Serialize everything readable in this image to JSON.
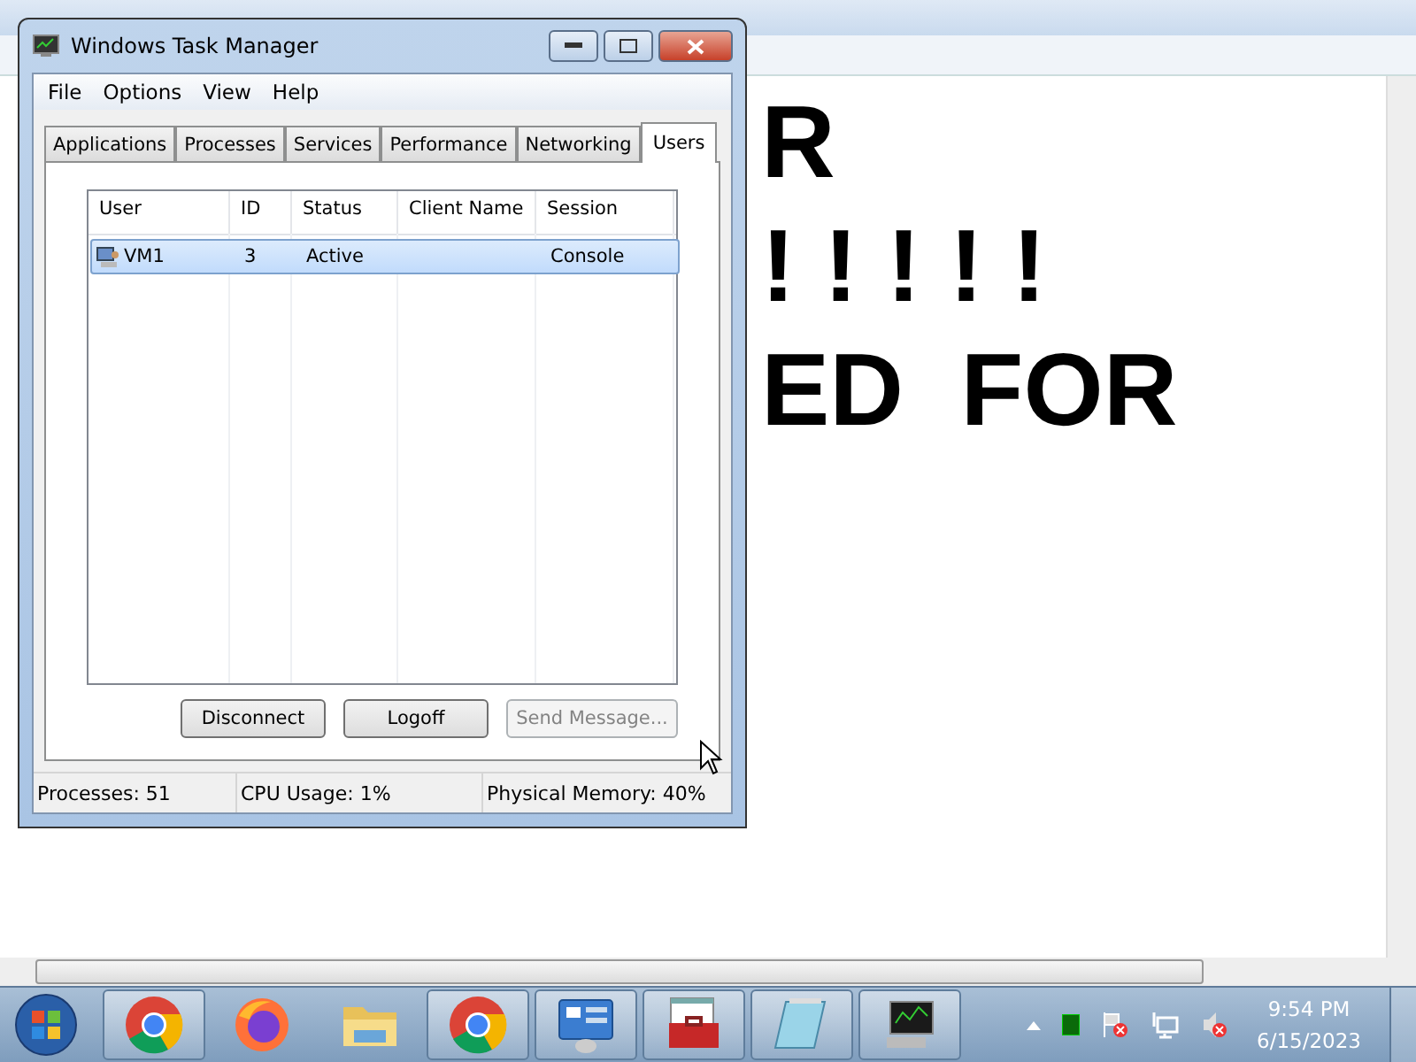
{
  "notepad": {
    "text_lines": [
      "R",
      "! ! ! ! !",
      "ED  FOR"
    ]
  },
  "task_manager": {
    "title": "Windows Task Manager",
    "menu": [
      "File",
      "Options",
      "View",
      "Help"
    ],
    "tabs": [
      {
        "label": "Applications",
        "selected": false
      },
      {
        "label": "Processes",
        "selected": false
      },
      {
        "label": "Services",
        "selected": false
      },
      {
        "label": "Performance",
        "selected": false
      },
      {
        "label": "Networking",
        "selected": false
      },
      {
        "label": "Users",
        "selected": true
      }
    ],
    "table": {
      "columns": [
        "User",
        "ID",
        "Status",
        "Client Name",
        "Session"
      ],
      "rows": [
        {
          "cells": [
            "VM1",
            "3",
            "Active",
            "",
            "Console"
          ],
          "selected": true
        }
      ]
    },
    "buttons": [
      {
        "label": "Disconnect",
        "disabled": false
      },
      {
        "label": "Logoff",
        "disabled": false
      },
      {
        "label": "Send Message...",
        "disabled": true
      }
    ],
    "status_bar": [
      "Processes: 51",
      "CPU Usage: 1%",
      "Physical Memory: 40%"
    ]
  },
  "taskbar": {
    "apps": [
      {
        "kind": "chrome",
        "active": true
      },
      {
        "kind": "firefox",
        "active": false
      },
      {
        "kind": "folder",
        "active": false
      },
      {
        "kind": "chrome",
        "active": true
      },
      {
        "kind": "panel",
        "active": true
      },
      {
        "kind": "toolbox",
        "active": true
      },
      {
        "kind": "notepad",
        "active": true
      },
      {
        "kind": "monitor",
        "active": true
      }
    ],
    "time": "9:54 PM",
    "date": "6/15/2023"
  }
}
